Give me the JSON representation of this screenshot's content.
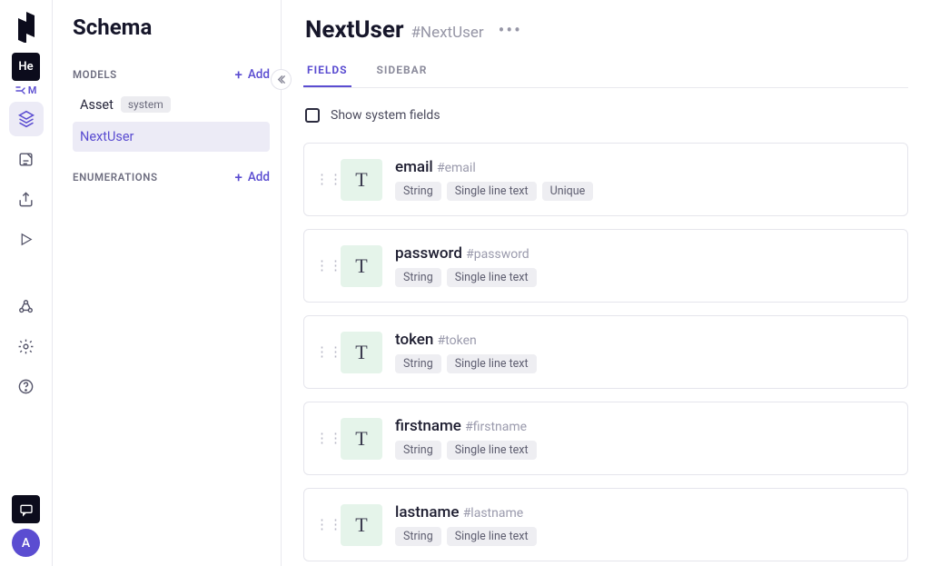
{
  "rail": {
    "project_badge": "He",
    "project_sub": "M",
    "avatar": "A"
  },
  "sidebar": {
    "title": "Schema",
    "sections": {
      "models_label": "MODELS",
      "enums_label": "ENUMERATIONS",
      "add_label": "Add"
    },
    "models": [
      {
        "name": "Asset",
        "tag": "system",
        "selected": false
      },
      {
        "name": "NextUser",
        "tag": null,
        "selected": true
      }
    ]
  },
  "main": {
    "model_title": "NextUser",
    "model_api_id": "#NextUser",
    "tabs": [
      {
        "label": "FIELDS",
        "active": true
      },
      {
        "label": "SIDEBAR",
        "active": false
      }
    ],
    "show_system_label": "Show system fields",
    "type_tile_letter": "T",
    "fields": [
      {
        "name": "email",
        "api_id": "#email",
        "pills": [
          "String",
          "Single line text",
          "Unique"
        ]
      },
      {
        "name": "password",
        "api_id": "#password",
        "pills": [
          "String",
          "Single line text"
        ]
      },
      {
        "name": "token",
        "api_id": "#token",
        "pills": [
          "String",
          "Single line text"
        ]
      },
      {
        "name": "firstname",
        "api_id": "#firstname",
        "pills": [
          "String",
          "Single line text"
        ]
      },
      {
        "name": "lastname",
        "api_id": "#lastname",
        "pills": [
          "String",
          "Single line text"
        ]
      }
    ]
  }
}
